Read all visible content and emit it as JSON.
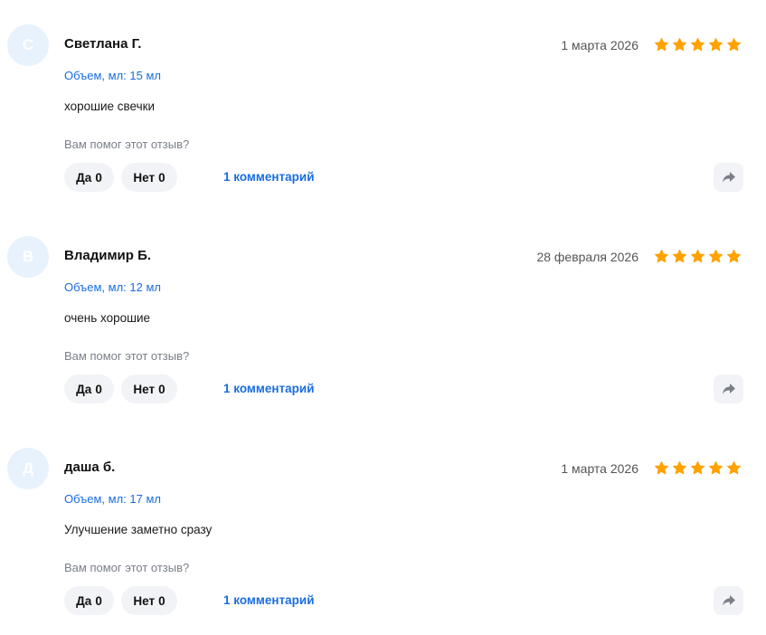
{
  "reviews": [
    {
      "initial": "С",
      "name": "Светлана Г.",
      "date": "1 марта 2026",
      "rating": 5,
      "volume": "Объем, мл: 15 мл",
      "text": "хорошие свечки",
      "helpful_question": "Вам помог этот отзыв?",
      "yes_label": "Да",
      "yes_count": "0",
      "no_label": "Нет",
      "no_count": "0",
      "comments": "1 комментарий"
    },
    {
      "initial": "В",
      "name": "Владимир Б.",
      "date": "28 февраля 2026",
      "rating": 5,
      "volume": "Объем, мл: 12 мл",
      "text": "очень хорошие",
      "helpful_question": "Вам помог этот отзыв?",
      "yes_label": "Да",
      "yes_count": "0",
      "no_label": "Нет",
      "no_count": "0",
      "comments": "1 комментарий"
    },
    {
      "initial": "Д",
      "name": "даша б.",
      "date": "1 марта 2026",
      "rating": 5,
      "volume": "Объем, мл: 17 мл",
      "text": "Улучшение заметно сразу",
      "helpful_question": "Вам помог этот отзыв?",
      "yes_label": "Да",
      "yes_count": "0",
      "no_label": "Нет",
      "no_count": "0",
      "comments": "1 комментарий"
    }
  ],
  "colors": {
    "star": "#ffa200",
    "link": "#1a6de1",
    "avatar_bg": "#e8f2fd",
    "button_bg": "#f2f3f6"
  },
  "icons": {
    "star": "star-icon",
    "share": "share-arrow-icon"
  }
}
